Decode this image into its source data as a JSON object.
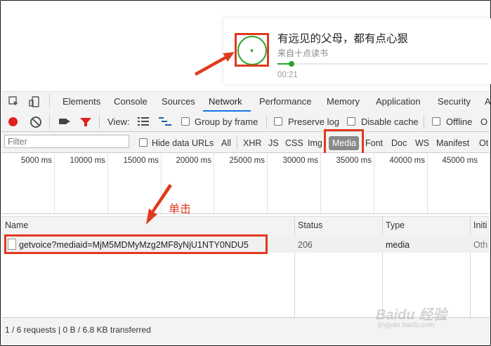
{
  "audio": {
    "title": "有远见的父母，都有点心狠",
    "source": "来自十点读书",
    "elapsed": "00:21",
    "progress": 0.07
  },
  "devtools": {
    "tabs": [
      "Elements",
      "Console",
      "Sources",
      "Network",
      "Performance",
      "Memory",
      "Application",
      "Security",
      "A"
    ],
    "active_tab": "Network",
    "toolbar": {
      "view_label": "View:",
      "group_by_frame": "Group by frame",
      "preserve_log": "Preserve log",
      "disable_cache": "Disable cache",
      "offline": "Offline",
      "overflow": "O"
    },
    "filter": {
      "placeholder": "Filter",
      "hide_data_urls": "Hide data URLs",
      "types": [
        "All",
        "XHR",
        "JS",
        "CSS",
        "Img",
        "Media",
        "Font",
        "Doc",
        "WS",
        "Manifest",
        "Ot"
      ],
      "active_type": "Media"
    },
    "timeline_ticks": [
      "5000 ms",
      "10000 ms",
      "15000 ms",
      "20000 ms",
      "25000 ms",
      "30000 ms",
      "35000 ms",
      "40000 ms",
      "45000 ms"
    ],
    "table": {
      "columns": [
        "Name",
        "Status",
        "Type",
        "Initi"
      ],
      "rows": [
        {
          "name": "getvoice?mediaid=MjM5MDMyMzg2MF8yNjU1NTY0NDU5",
          "status": "206",
          "type": "media",
          "initiator": "Oth"
        }
      ]
    },
    "status_bar": "1 / 6 requests  |  0 B / 6.8 KB transferred"
  },
  "annotation": "单击",
  "watermark": {
    "brand": "Baidu 经验",
    "url": "jingyan.baidu.com"
  },
  "colors": {
    "highlight": "#e03a1e",
    "accent_green": "#2aa52a",
    "record_red": "#e0201e",
    "active_tab": "#1a73e8"
  }
}
